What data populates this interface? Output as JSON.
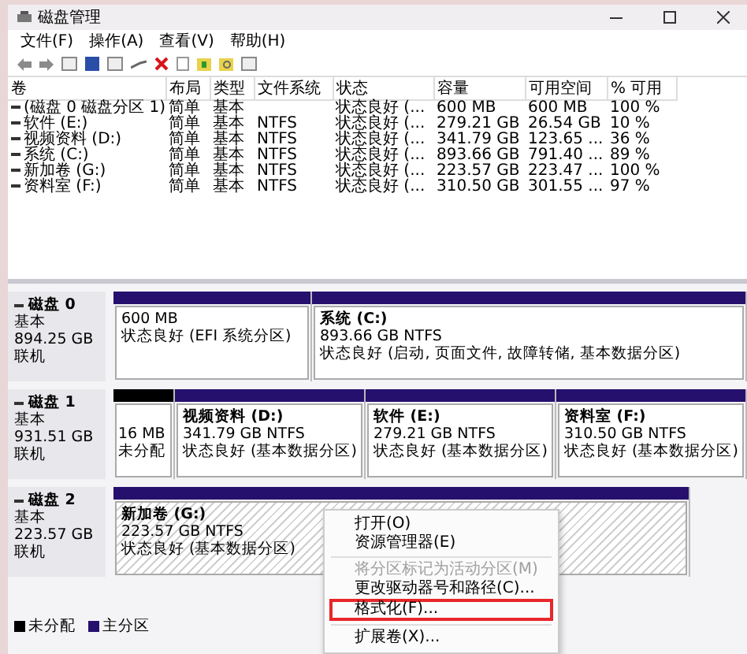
{
  "window": {
    "title": "磁盘管理"
  },
  "menu": [
    "文件(F)",
    "操作(A)",
    "查看(V)",
    "帮助(H)"
  ],
  "table": {
    "columns": [
      "卷",
      "布局",
      "类型",
      "文件系统",
      "状态",
      "容量",
      "可用空间",
      "% 可用"
    ],
    "rows": [
      [
        "(磁盘 0 磁盘分区 1)",
        "简单",
        "基本",
        "",
        "状态良好 (...",
        "600 MB",
        "600 MB",
        "100 %"
      ],
      [
        "软件 (E:)",
        "简单",
        "基本",
        "NTFS",
        "状态良好 (...",
        "279.21 GB",
        "26.54 GB",
        "10 %"
      ],
      [
        "视频资料 (D:)",
        "简单",
        "基本",
        "NTFS",
        "状态良好 (...",
        "341.79 GB",
        "123.65 ...",
        "36 %"
      ],
      [
        "系统 (C:)",
        "简单",
        "基本",
        "NTFS",
        "状态良好 (...",
        "893.66 GB",
        "791.40 ...",
        "89 %"
      ],
      [
        "新加卷 (G:)",
        "简单",
        "基本",
        "NTFS",
        "状态良好 (...",
        "223.57 GB",
        "223.47 ...",
        "100 %"
      ],
      [
        "资料室 (F:)",
        "简单",
        "基本",
        "NTFS",
        "状态良好 (...",
        "310.50 GB",
        "301.55 ...",
        "97 %"
      ]
    ]
  },
  "disks": [
    {
      "name": "磁盘 0",
      "type": "基本",
      "size": "894.25 GB",
      "status": "联机",
      "partitions": [
        {
          "kind": "primary",
          "size": "600 MB",
          "status": "状态良好 (EFI 系统分区)",
          "selected": false
        },
        {
          "kind": "primary",
          "name": "系统 (C:)",
          "size": "893.66 GB NTFS",
          "status": "状态良好 (启动, 页面文件, 故障转储, 基本数据分区)",
          "selected": false
        }
      ]
    },
    {
      "name": "磁盘 1",
      "type": "基本",
      "size": "931.51 GB",
      "status": "联机",
      "partitions": [
        {
          "kind": "unallocated",
          "size": "16 MB",
          "status": "未分配",
          "selected": false
        },
        {
          "kind": "primary",
          "name": "视频资料 (D:)",
          "size": "341.79 GB NTFS",
          "status": "状态良好 (基本数据分区)",
          "selected": false
        },
        {
          "kind": "primary",
          "name": "软件 (E:)",
          "size": "279.21 GB NTFS",
          "status": "状态良好 (基本数据分区)",
          "selected": false
        },
        {
          "kind": "primary",
          "name": "资料室 (F:)",
          "size": "310.50 GB NTFS",
          "status": "状态良好 (基本数据分区)",
          "selected": false
        }
      ]
    },
    {
      "name": "磁盘 2",
      "type": "基本",
      "size": "223.57 GB",
      "status": "联机",
      "partitions": [
        {
          "kind": "primary",
          "name": "新加卷 (G:)",
          "size": "223.57 GB NTFS",
          "status": "状态良好 (基本数据分区)",
          "selected": true
        }
      ]
    }
  ],
  "legend": [
    {
      "kind": "unallocated",
      "label": "未分配"
    },
    {
      "kind": "primary",
      "label": "主分区"
    }
  ],
  "context_menu": [
    {
      "kind": "item",
      "label": "打开(O)",
      "disabled": false,
      "highlighted": false
    },
    {
      "kind": "item",
      "label": "资源管理器(E)",
      "disabled": false,
      "highlighted": false
    },
    {
      "kind": "separator"
    },
    {
      "kind": "item",
      "label": "将分区标记为活动分区(M)",
      "disabled": true,
      "highlighted": false
    },
    {
      "kind": "item",
      "label": "更改驱动器号和路径(C)...",
      "disabled": false,
      "highlighted": false
    },
    {
      "kind": "item",
      "label": "格式化(F)...",
      "disabled": false,
      "highlighted": true
    },
    {
      "kind": "separator"
    },
    {
      "kind": "item",
      "label": "扩展卷(X)...",
      "disabled": false,
      "highlighted": false
    }
  ]
}
